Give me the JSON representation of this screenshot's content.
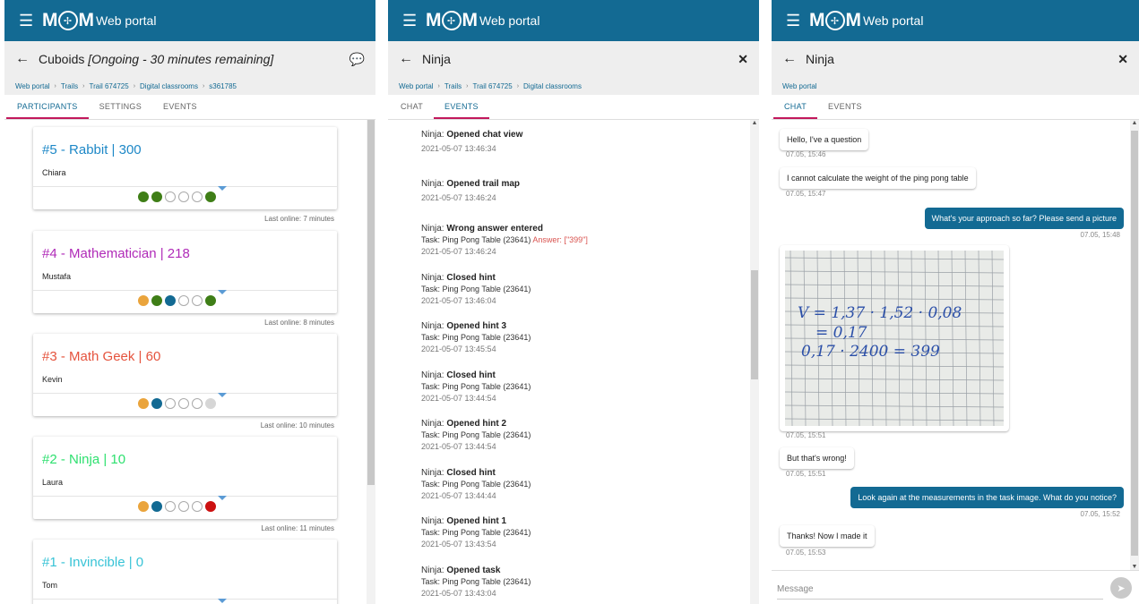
{
  "app": {
    "logo": "MOM",
    "title": "Web portal",
    "menu_icon": "hamburger-icon"
  },
  "panel1": {
    "title": "Cuboids ",
    "status": "[Ongoing - 30 minutes remaining]",
    "breadcrumb": [
      "Web portal",
      "Trails",
      "Trail 674725",
      "Digital classrooms",
      "s361785"
    ],
    "tabs": [
      "PARTICIPANTS",
      "SETTINGS",
      "EVENTS"
    ],
    "participants": [
      {
        "rank": "#5 - Rabbit | 300",
        "name": "Chiara",
        "color": "#1e88c7",
        "dots": [
          "#3f7e17",
          "#3f7e17",
          "#ffffff",
          "#ffffff",
          "#ffffff",
          "#3f7e17"
        ],
        "last_online": "Last online: 7 minutes"
      },
      {
        "rank": "#4 - Mathematician | 218",
        "name": "Mustafa",
        "color": "#b02bb8",
        "dots": [
          "#eaa43c",
          "#3f7e17",
          "#136a93",
          "#ffffff",
          "#ffffff",
          "#3f7e17"
        ],
        "last_online": "Last online: 8 minutes"
      },
      {
        "rank": "#3 - Math Geek | 60",
        "name": "Kevin",
        "color": "#e5533d",
        "dots": [
          "#eaa43c",
          "#136a93",
          "#ffffff",
          "#ffffff",
          "#ffffff",
          "#d6d6d6"
        ],
        "last_online": "Last online: 10 minutes"
      },
      {
        "rank": "#2 - Ninja | 10",
        "name": "Laura",
        "color": "#2ee06f",
        "dots": [
          "#eaa43c",
          "#136a93",
          "#ffffff",
          "#ffffff",
          "#ffffff",
          "#cc1111"
        ],
        "last_online": "Last online: 11 minutes"
      },
      {
        "rank": "#1 - Invincible | 0",
        "name": "Tom",
        "color": "#37c3d6",
        "dots": [],
        "last_online": ""
      }
    ]
  },
  "panel2": {
    "title": "Ninja",
    "breadcrumb": [
      "Web portal",
      "Trails",
      "Trail 674725",
      "Digital classrooms"
    ],
    "tabs": [
      "CHAT",
      "EVENTS"
    ],
    "events": [
      {
        "who": "Ninja: ",
        "action": "Opened chat view",
        "task": "",
        "answer": "",
        "time": "2021-05-07 13:46:34"
      },
      {
        "who": "Ninja: ",
        "action": "Opened trail map",
        "task": "",
        "answer": "",
        "time": "2021-05-07 13:46:24"
      },
      {
        "who": "Ninja: ",
        "action": "Wrong answer entered",
        "task": "Task: Ping Pong Table (23641)",
        "answer": " Answer: [\"399\"]",
        "time": "2021-05-07 13:46:24"
      },
      {
        "who": "Ninja: ",
        "action": "Closed hint",
        "task": "Task: Ping Pong Table (23641)",
        "answer": "",
        "time": "2021-05-07 13:46:04"
      },
      {
        "who": "Ninja: ",
        "action": "Opened hint 3",
        "task": "Task: Ping Pong Table (23641)",
        "answer": "",
        "time": "2021-05-07 13:45:54"
      },
      {
        "who": "Ninja: ",
        "action": "Closed hint",
        "task": "Task: Ping Pong Table (23641)",
        "answer": "",
        "time": "2021-05-07 13:44:54"
      },
      {
        "who": "Ninja: ",
        "action": "Opened hint 2",
        "task": "Task: Ping Pong Table (23641)",
        "answer": "",
        "time": "2021-05-07 13:44:54"
      },
      {
        "who": "Ninja: ",
        "action": "Closed hint",
        "task": "Task: Ping Pong Table (23641)",
        "answer": "",
        "time": "2021-05-07 13:44:44"
      },
      {
        "who": "Ninja: ",
        "action": "Opened hint 1",
        "task": "Task: Ping Pong Table (23641)",
        "answer": "",
        "time": "2021-05-07 13:43:54"
      },
      {
        "who": "Ninja: ",
        "action": "Opened task",
        "task": "Task: Ping Pong Table (23641)",
        "answer": "",
        "time": "2021-05-07 13:43:04"
      }
    ]
  },
  "panel3": {
    "title": "Ninja",
    "breadcrumb": [
      "Web portal"
    ],
    "tabs": [
      "CHAT",
      "EVENTS"
    ],
    "messages": [
      {
        "dir": "in",
        "text": "Hello, I've a question",
        "time": "07.05, 15:46"
      },
      {
        "dir": "in",
        "text": "I cannot calculate the weight of the ping pong table",
        "time": "07.05, 15:47"
      },
      {
        "dir": "out",
        "text": "What's your approach so far? Please send a picture",
        "time": "07.05, 15:48"
      },
      {
        "dir": "in",
        "text": "",
        "time": "07.05, 15:51"
      },
      {
        "dir": "in",
        "text": "But that's wrong!",
        "time": "07.05, 15:51"
      },
      {
        "dir": "out",
        "text": "Look again at the measurements in the task image. What do you notice?",
        "time": "07.05, 15:52"
      },
      {
        "dir": "in",
        "text": "Thanks! Now I made it",
        "time": "07.05, 15:53"
      }
    ],
    "photo_lines": [
      "V = 1,37 · 1,52 · 0,08",
      "= 0,17",
      "0,17 · 2400 = 399"
    ],
    "message_placeholder": "Message",
    "send_icon": "send-icon"
  }
}
